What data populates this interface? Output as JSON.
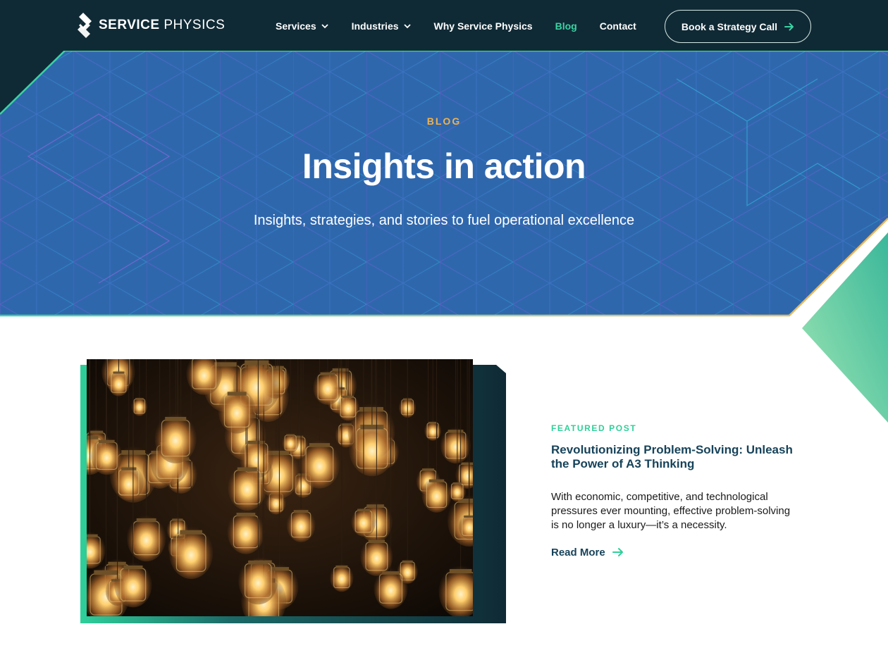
{
  "brand": {
    "name_bold": "SERVICE",
    "name_light": "PHYSICS"
  },
  "nav": {
    "items": [
      {
        "label": "Services",
        "has_dropdown": true
      },
      {
        "label": "Industries",
        "has_dropdown": true
      },
      {
        "label": "Why Service Physics",
        "has_dropdown": false
      },
      {
        "label": "Blog",
        "has_dropdown": false,
        "active": true
      },
      {
        "label": "Contact",
        "has_dropdown": false
      }
    ],
    "cta_label": "Book a Strategy Call",
    "cta_icon": "arrow-right-icon"
  },
  "hero": {
    "eyebrow": "BLOG",
    "title": "Insights in action",
    "subtitle": "Insights, strategies, and stories to fuel operational excellence"
  },
  "featured": {
    "eyebrow": "FEATURED POST",
    "title": "Revolutionizing Problem-Solving: Unleash the Power of A3 Thinking",
    "excerpt": "With economic, competitive, and technological pressures ever mounting, effective problem-solving is no longer a luxury—it’s a necessity.",
    "read_more": "Read More",
    "image_subject": "hanging jar light bulbs"
  },
  "colors": {
    "header_bg": "#102a35",
    "hero_blue": "#2f67ad",
    "accent_green": "#3ad3a3",
    "accent_gold": "#f2b24c",
    "heading_navy": "#17435a"
  }
}
